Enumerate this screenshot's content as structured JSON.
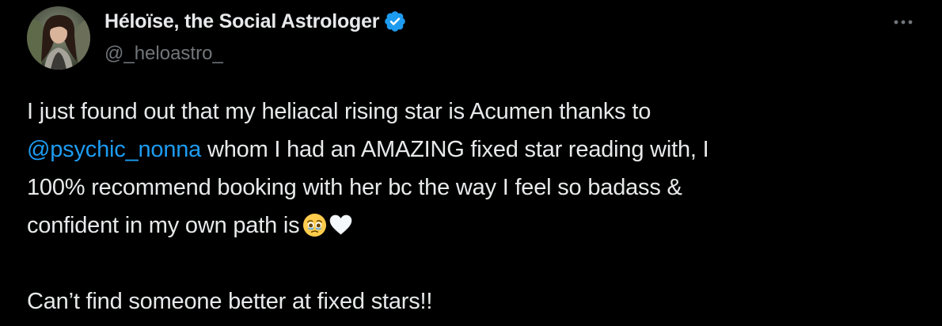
{
  "author": {
    "display_name": "Héloïse, the Social Astrologer",
    "handle": "@_heloastro_",
    "verified": true,
    "verified_color": "#1d9bf0"
  },
  "icons": {
    "verified": "verified-badge-icon",
    "more": "more-options-icon",
    "emoji_1": "face-holding-back-tears-emoji",
    "emoji_2": "white-heart-emoji"
  },
  "tweet": {
    "line1": "I just found out that my heliacal rising star is Acumen thanks to",
    "mention": "@psychic_nonna",
    "line2_rest": " whom I had an AMAZING fixed star reading with, I",
    "line3": "100% recommend booking with her bc the way I feel so badass &",
    "line4": "confident in my own path is",
    "line5": "Can’t find someone better at fixed stars!!"
  },
  "colors": {
    "background": "#000000",
    "text": "#e7e9ea",
    "secondary_text": "#71767b",
    "link": "#1d9bf0"
  }
}
